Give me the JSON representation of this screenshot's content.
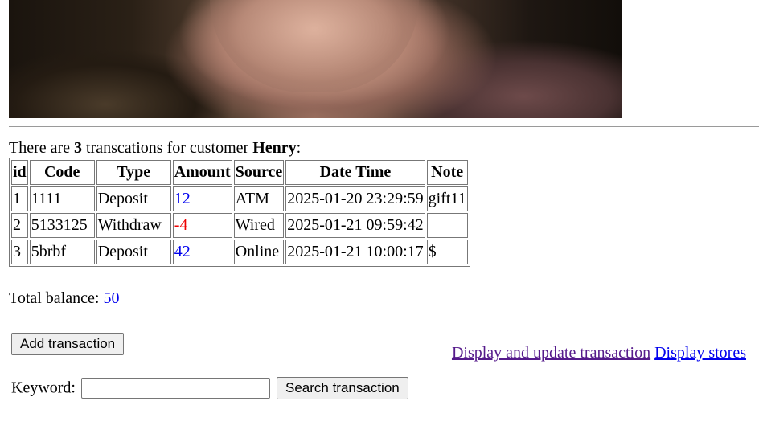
{
  "photo": {
    "icon": "customer-photo"
  },
  "summary": {
    "prefix": "There are",
    "count": "3",
    "middle": "transcations for customer",
    "customer": "Henry",
    "suffix": ":"
  },
  "table": {
    "headers": [
      "id",
      "Code",
      "Type",
      "Amount",
      "Source",
      "Date Time",
      "Note"
    ],
    "rows": [
      {
        "id": "1",
        "code": "1111",
        "type": "Deposit",
        "amount": "12",
        "source": "ATM",
        "datetime": "2025-01-20 23:29:59",
        "note": "gift11"
      },
      {
        "id": "2",
        "code": "5133125",
        "type": "Withdraw",
        "amount": "-4",
        "source": "Wired",
        "datetime": "2025-01-21 09:59:42",
        "note": ""
      },
      {
        "id": "3",
        "code": "5brbf",
        "type": "Deposit",
        "amount": "42",
        "source": "Online",
        "datetime": "2025-01-21 10:00:17",
        "note": "$"
      }
    ]
  },
  "balance": {
    "label": "Total balance:",
    "value": "50"
  },
  "actions": {
    "add_label": "Add transaction",
    "display_update_label": "Display and update transaction",
    "display_stores_label": "Display stores"
  },
  "search": {
    "keyword_label": "Keyword:",
    "value": "",
    "button_label": "Search transaction"
  },
  "colors": {
    "positive": "#0000ee",
    "negative": "#ee0000",
    "visited_link": "#551a8b",
    "link": "#0000ee"
  }
}
